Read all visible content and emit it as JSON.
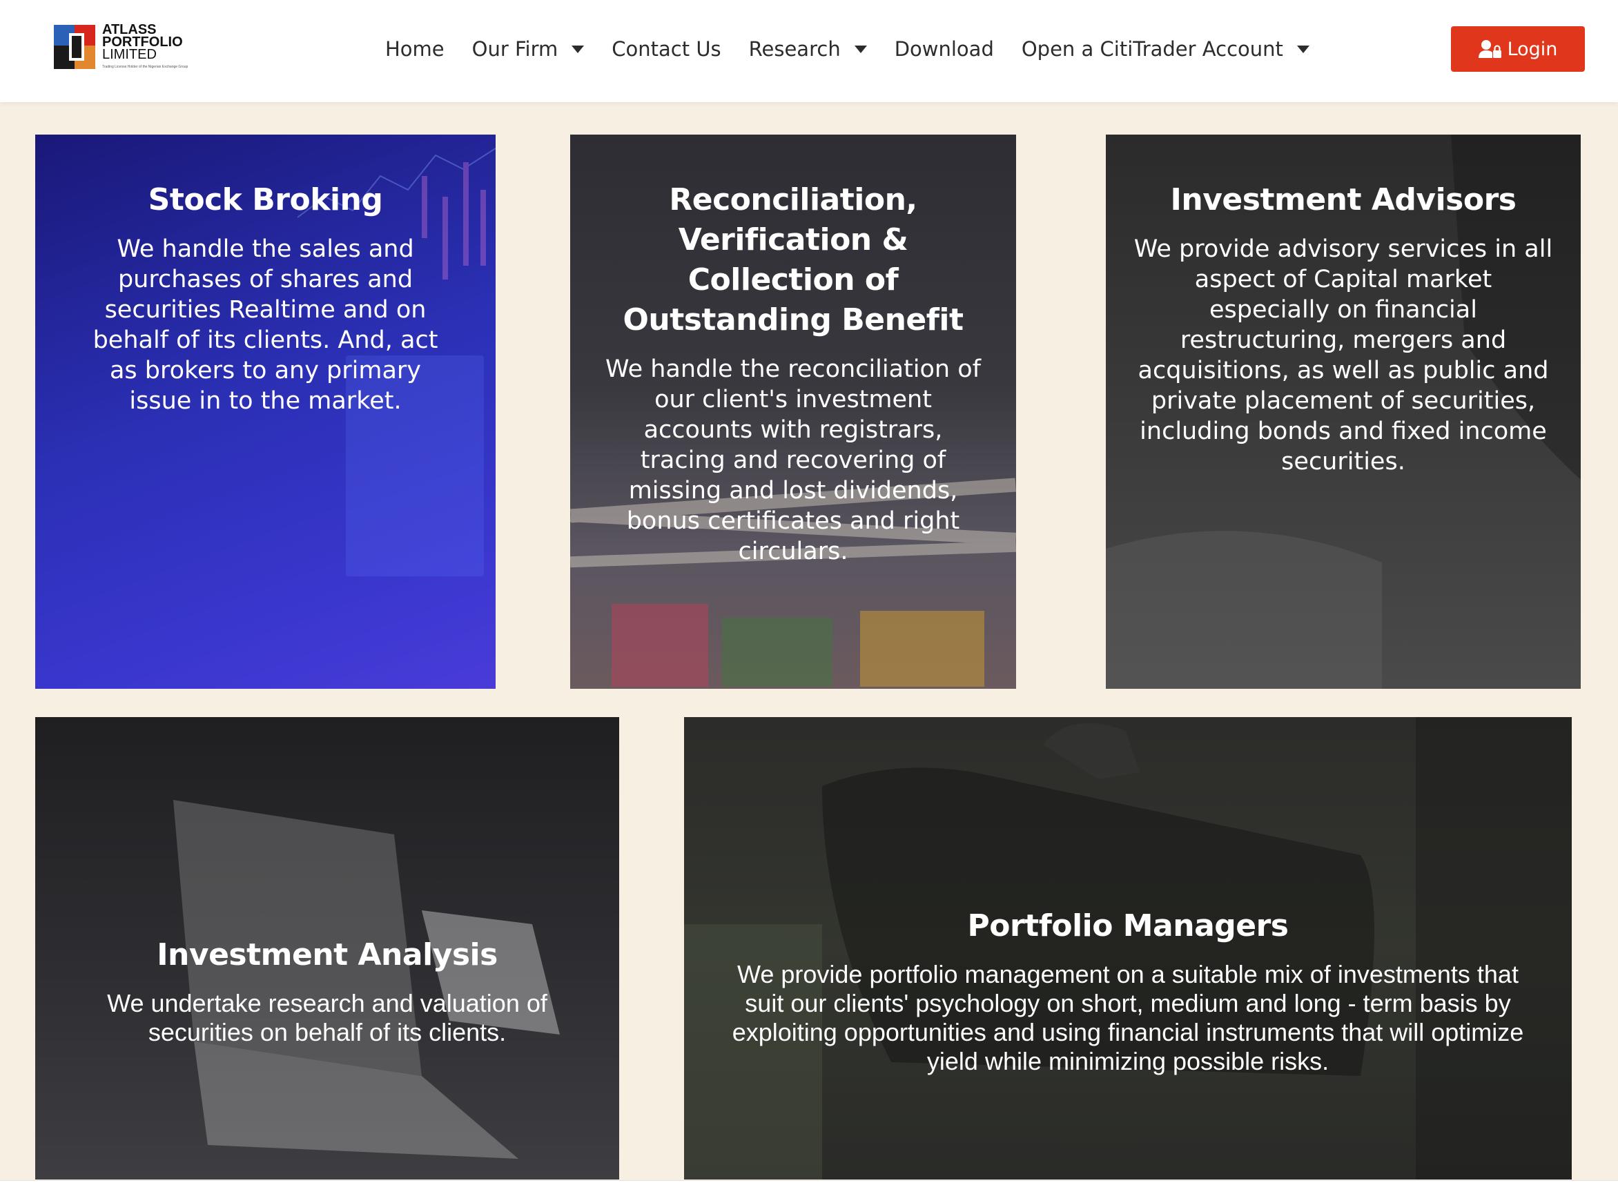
{
  "logo": {
    "line1": "ATLASS",
    "line2": "PORTFOLIO",
    "line3": "LIMITED",
    "tagline": "Trading License Holder of the Nigerian Exchange Group"
  },
  "nav": {
    "items": [
      {
        "label": "Home"
      },
      {
        "label": "Our Firm"
      },
      {
        "label": "Contact Us"
      },
      {
        "label": "Research"
      },
      {
        "label": "Download"
      },
      {
        "label": "Open a CitiTrader Account"
      }
    ],
    "login_label": "Login"
  },
  "cards": [
    {
      "title": "Stock Broking",
      "text": "We handle the sales and purchases of shares and securities Realtime and on behalf of its clients. And, act as brokers to any primary issue in to the market."
    },
    {
      "title": "Reconciliation, Verification & Collection of Outstanding Benefit",
      "text": "We handle the reconciliation of our client's investment accounts with registrars, tracing and recovering of missing and lost dividends, bonus certificates and right circulars."
    },
    {
      "title": "Investment Advisors",
      "text": "We provide advisory services in all aspect of Capital market especially on financial restructuring, mergers and acquisitions, as well as public and private placement of securities, including bonds and fixed income securities."
    },
    {
      "title": "Investment Analysis",
      "text": "We undertake research and valuation of securities on behalf of its clients."
    },
    {
      "title": "Portfolio Managers",
      "text": "We provide portfolio management on a suitable mix of investments that suit our clients' psychology on short, medium and long - term basis by exploiting opportunities and using financial instruments that will optimize yield while minimizing possible risks."
    }
  ],
  "colors": {
    "login_bg": "#e0361b",
    "page_bg": "#f6efe2",
    "nav_text": "#2c2c2c"
  }
}
